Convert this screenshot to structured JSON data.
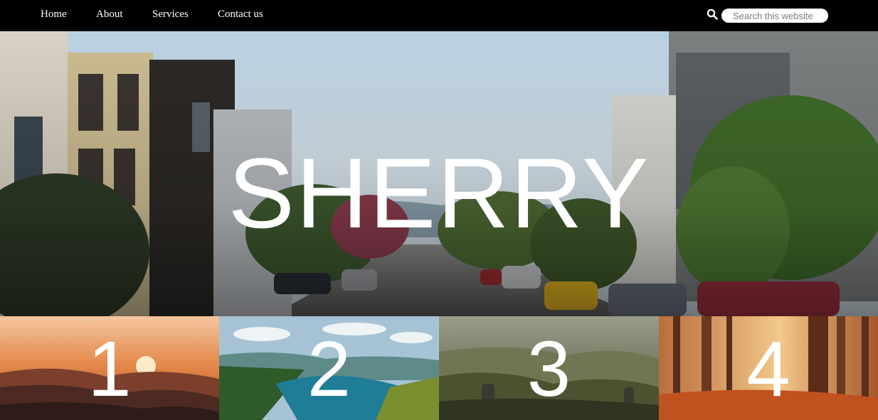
{
  "nav": {
    "items": [
      {
        "label": "Home"
      },
      {
        "label": "About"
      },
      {
        "label": "Services"
      },
      {
        "label": "Contact us"
      }
    ],
    "search": {
      "placeholder": "Search this website",
      "icon": "search-icon"
    }
  },
  "hero": {
    "title": "SHERRY"
  },
  "tiles": [
    {
      "label": "1"
    },
    {
      "label": "2"
    },
    {
      "label": "3"
    },
    {
      "label": "4"
    }
  ]
}
